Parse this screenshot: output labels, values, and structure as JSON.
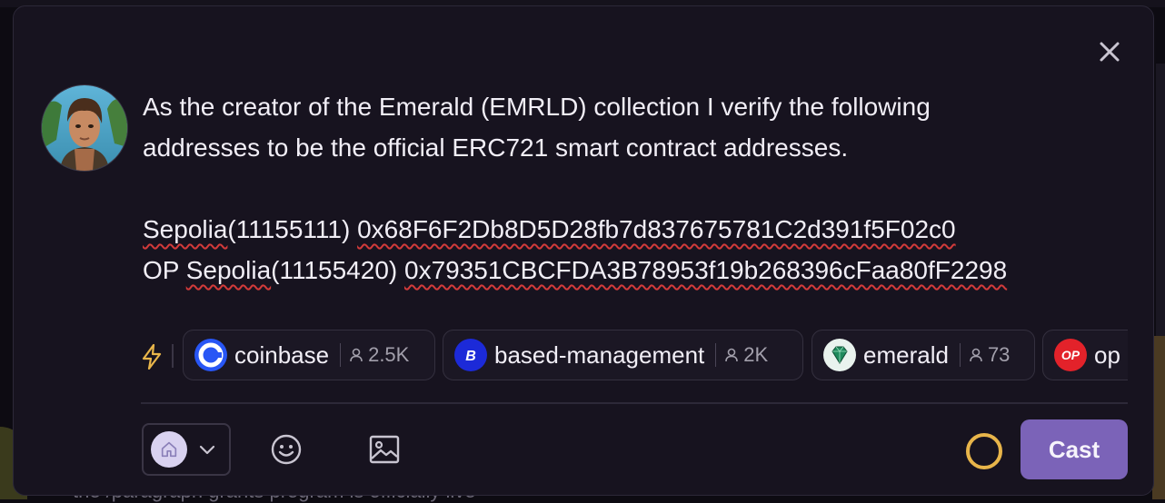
{
  "background": {
    "footer_text": "the /paragraph grants program is officially live"
  },
  "composer": {
    "close_icon": "close-icon",
    "author_avatar": "avatar",
    "message": {
      "line1": "As the creator of the Emerald (EMRLD) collection I verify the following",
      "line2": "addresses to be the official ERC721 smart contract addresses.",
      "line3_prefix": "Sepolia",
      "line3_suffix": "(11155111) ",
      "line3_address": "0x68F6F2Db8D5D28fb7d837675781C2d391f5F02c0",
      "line4_op": "OP ",
      "line4_prefix": "Sepolia",
      "line4_suffix": "(11155420) ",
      "line4_address": "0x79351CBCFDA3B78953f19b268396cFaa80fF2298"
    },
    "channels": [
      {
        "name": "coinbase",
        "members": "2.5K",
        "icon": "coinbase-icon",
        "color": "#2856f5"
      },
      {
        "name": "based-management",
        "members": "2K",
        "icon": "based-management-icon",
        "color": "#1c2ad8"
      },
      {
        "name": "emerald",
        "members": "73",
        "icon": "emerald-icon",
        "color": "#e9f3ee"
      },
      {
        "name": "op",
        "members": "",
        "icon": "optimism-icon",
        "color": "#e3222a",
        "icon_text": "OP"
      }
    ],
    "toolbar": {
      "home_icon": "home-icon",
      "chevron_icon": "chevron-down-icon",
      "emoji_icon": "smile-icon",
      "image_icon": "image-icon",
      "cast_label": "Cast"
    },
    "colors": {
      "accent": "#7b63b8",
      "progress": "#e8b54a"
    }
  }
}
